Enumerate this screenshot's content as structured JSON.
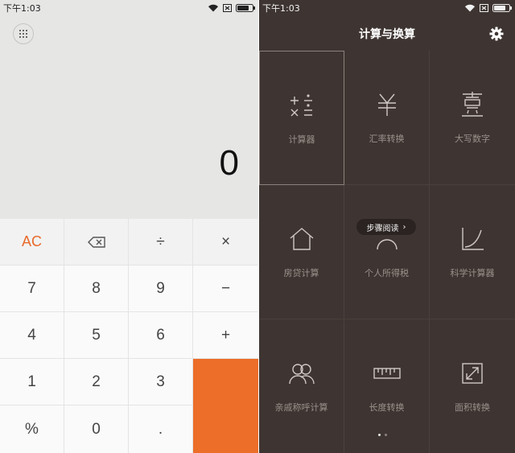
{
  "left": {
    "status": {
      "time": "下午1:03"
    },
    "display": {
      "value": "0"
    },
    "keys": {
      "ac": "AC",
      "backspace": "⌫",
      "divide": "÷",
      "multiply": "×",
      "seven": "7",
      "eight": "8",
      "nine": "9",
      "minus": "−",
      "four": "4",
      "five": "5",
      "six": "6",
      "plus": "+",
      "one": "1",
      "two": "2",
      "three": "3",
      "percent": "%",
      "zero": "0",
      "dot": "."
    },
    "colors": {
      "accent": "#ec6e29",
      "ac_text": "#e8692b"
    }
  },
  "right": {
    "status": {
      "time": "下午1:03"
    },
    "header": {
      "title": "计算与换算"
    },
    "tiles": [
      {
        "label": "计算器",
        "icon": "calculator-ops-icon"
      },
      {
        "label": "汇率转换",
        "icon": "yuan-icon"
      },
      {
        "label": "大写数字",
        "icon": "chinese-numeral-icon"
      },
      {
        "label": "房贷计算",
        "icon": "house-icon"
      },
      {
        "label": "个人所得税",
        "icon": "tax-icon"
      },
      {
        "label": "科学计算器",
        "icon": "curve-chart-icon"
      },
      {
        "label": "亲戚称呼计算",
        "icon": "people-icon"
      },
      {
        "label": "长度转换",
        "icon": "ruler-icon"
      },
      {
        "label": "面积转换",
        "icon": "resize-icon"
      }
    ],
    "step_pill": {
      "label": "步骤阅读",
      "arrow": "›"
    },
    "colors": {
      "background": "#3e3532",
      "label": "#9a908b"
    }
  }
}
